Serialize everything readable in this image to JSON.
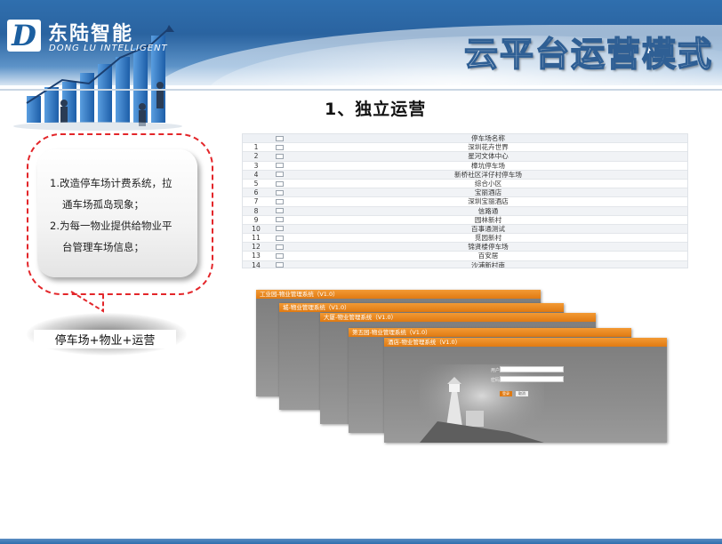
{
  "brand": {
    "logo_letter": "D",
    "name_cn": "东陆智能",
    "name_en": "DONG LU INTELLIGENT"
  },
  "slogan": "云平台运营模式",
  "section_title": "1、独立运营",
  "bubble": {
    "lines": [
      "1.改造停车场计费系统，拉",
      "通车场孤岛现象；",
      "2.为每一物业提供给物业平",
      "台管理车场信息；"
    ]
  },
  "caption": "停车场+物业+运营",
  "table": {
    "header": "停车场名称",
    "rows": [
      {
        "no": "1",
        "name": "深圳花卉世界"
      },
      {
        "no": "2",
        "name": "星河文体中心"
      },
      {
        "no": "3",
        "name": "樟坑停车场"
      },
      {
        "no": "4",
        "name": "新桥社区洋仔村停车场"
      },
      {
        "no": "5",
        "name": "综合小区"
      },
      {
        "no": "6",
        "name": "宝丽酒店"
      },
      {
        "no": "7",
        "name": "深圳宝丽酒店"
      },
      {
        "no": "8",
        "name": "信路通"
      },
      {
        "no": "9",
        "name": "园林新村"
      },
      {
        "no": "10",
        "name": "百事通测试"
      },
      {
        "no": "11",
        "name": "觅园新村"
      },
      {
        "no": "12",
        "name": "锦贤楼停车场"
      },
      {
        "no": "13",
        "name": "百安居"
      },
      {
        "no": "14",
        "name": "沙浦新村南"
      }
    ]
  },
  "windows": [
    {
      "title": "工业园-物业管理系统（V1.0）"
    },
    {
      "title": "城-物业管理系统（V1.0）"
    },
    {
      "title": "大厦-物业管理系统（V1.0）"
    },
    {
      "title": "第五园-物业管理系统（V1.0）"
    },
    {
      "title": "酒店-物业管理系统（V1.0）"
    }
  ],
  "login": {
    "user_label": "用户",
    "pass_label": "密码",
    "login_btn": "登录",
    "cancel_btn": "取消"
  },
  "colors": {
    "header_blue": "#2a63a0",
    "dash_red": "#e3262a",
    "window_orange": "#e07a12"
  }
}
